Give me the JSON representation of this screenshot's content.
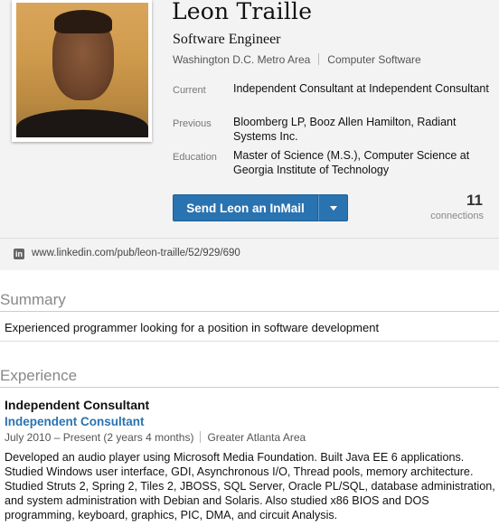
{
  "profile": {
    "name": "Leon Traille",
    "headline": "Software Engineer",
    "location": "Washington D.C. Metro Area",
    "industry": "Computer Software",
    "current_label": "Current",
    "current_value": "Independent Consultant at Independent Consultant",
    "previous_label": "Previous",
    "previous_value": "Bloomberg LP, Booz Allen Hamilton, Radiant Systems Inc.",
    "education_label": "Education",
    "education_value": "Master of Science (M.S.), Computer Science at Georgia Institute of Technology",
    "inmail_button": "Send Leon an InMail",
    "connections_count": "11",
    "connections_label": "connections",
    "public_url": "www.linkedin.com/pub/leon-traille/52/929/690"
  },
  "summary": {
    "heading": "Summary",
    "text": "Experienced programmer looking for a position in software development"
  },
  "experience": {
    "heading": "Experience",
    "items": [
      {
        "title": "Independent Consultant",
        "company": "Independent Consultant",
        "dates": "July 2010 – Present (2 years 4 months)",
        "location": "Greater Atlanta Area",
        "description": "Developed an audio player using Microsoft Media Foundation. Built Java EE 6 applications. Studied Windows user interface, GDI, Asynchronous I/O, Thread pools, memory architecture. Studied Struts 2, Spring 2, Tiles 2, JBOSS, SQL Server, Oracle PL/SQL, database administration, and system administration with Debian and Solaris. Also studied x86 BIOS and DOS programming, keyboard, graphics, PIC, DMA, and circuit Analysis."
      }
    ]
  },
  "icons": {
    "linkedin": "linkedin-icon",
    "dropdown": "chevron-down-icon"
  },
  "colors": {
    "accent": "#2a73b1",
    "header_bg": "#f3f3f3"
  }
}
